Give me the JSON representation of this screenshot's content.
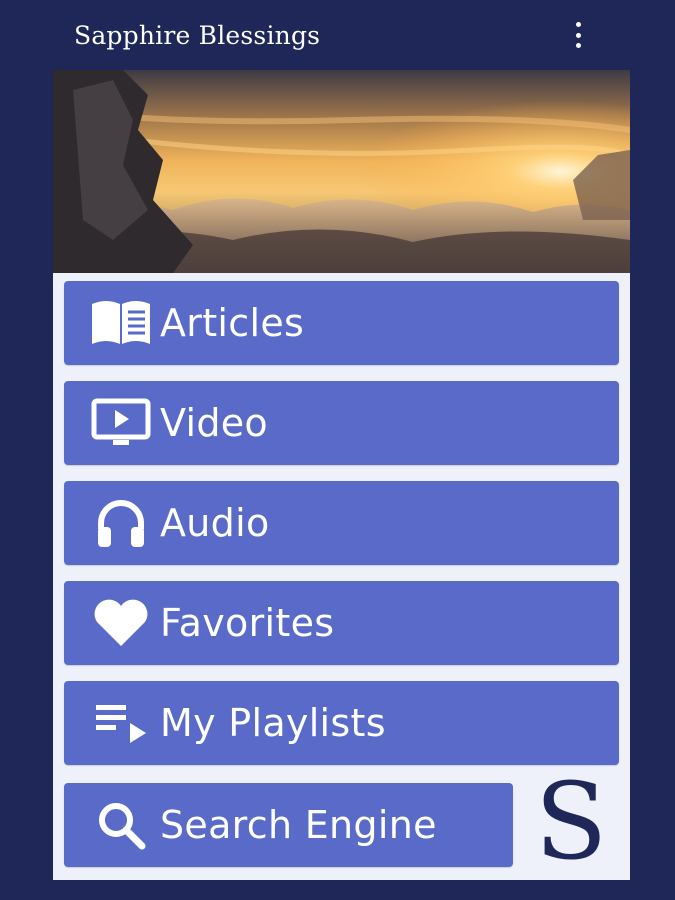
{
  "app": {
    "title": "Sapphire Blessings"
  },
  "header": {
    "menu_icon": "more-vert-icon"
  },
  "banner": {
    "description": "sunset-above-clouds-mountain"
  },
  "menu": {
    "items": [
      {
        "label": "Articles",
        "icon": "book-icon"
      },
      {
        "label": "Video",
        "icon": "video-icon"
      },
      {
        "label": "Audio",
        "icon": "headphones-icon"
      },
      {
        "label": "Favorites",
        "icon": "heart-icon"
      },
      {
        "label": "My Playlists",
        "icon": "playlist-icon"
      },
      {
        "label": "Search Engine",
        "icon": "search-icon"
      }
    ]
  },
  "brand": {
    "logo_letter": "S"
  },
  "colors": {
    "background": "#1f2758",
    "button": "#5a6ac8",
    "panel": "#eef0fa",
    "text": "#ffffff"
  }
}
